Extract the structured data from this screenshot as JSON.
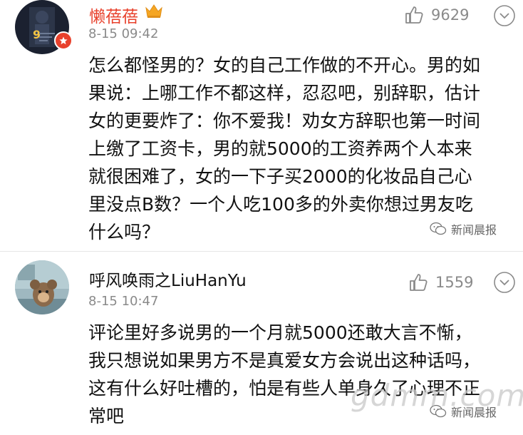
{
  "comments": [
    {
      "username": "懒蓓蓓",
      "timestamp": "8-15 09:42",
      "likes": "9629",
      "lines": [
        "怎么都怪男的？女的自己工作做的不开心。男的如",
        "果说：上哪工作不都这样，忍忍吧，别辞职，估计",
        "女的更要炸了：你不爱我！劝女方辞职也第一时间",
        "上缴了工资卡，男的就5000的工资养两个人本来",
        "就很困难了，女的一下子买2000的化妆品自己心",
        "里没点B数？一个人吃100多的外卖你想过男友吃",
        "什么吗？"
      ],
      "avatar_badge_text": "9",
      "source": "新闻晨报"
    },
    {
      "username": "呼风唤雨之LiuHanYu",
      "timestamp": "8-15 10:47",
      "likes": "1559",
      "lines": [
        "评论里好多说男的一个月就5000还敢大言不惭，",
        "我只想说如果男方不是真爱女方会说出这种话吗，",
        "这有什么好吐槽的，怕是有些人单身久了心理不正",
        "常吧"
      ],
      "source": "新闻晨报"
    }
  ],
  "watermark": "gdmm.com",
  "colors": {
    "text": "#111111",
    "meta": "#8a8a8a",
    "badge": "#e8412c",
    "crown": "#f5a623",
    "divider": "#e6e6e6"
  },
  "icons": [
    "thumbs-up-icon",
    "more-chevron-icon",
    "crown-icon",
    "wechat-icon"
  ]
}
